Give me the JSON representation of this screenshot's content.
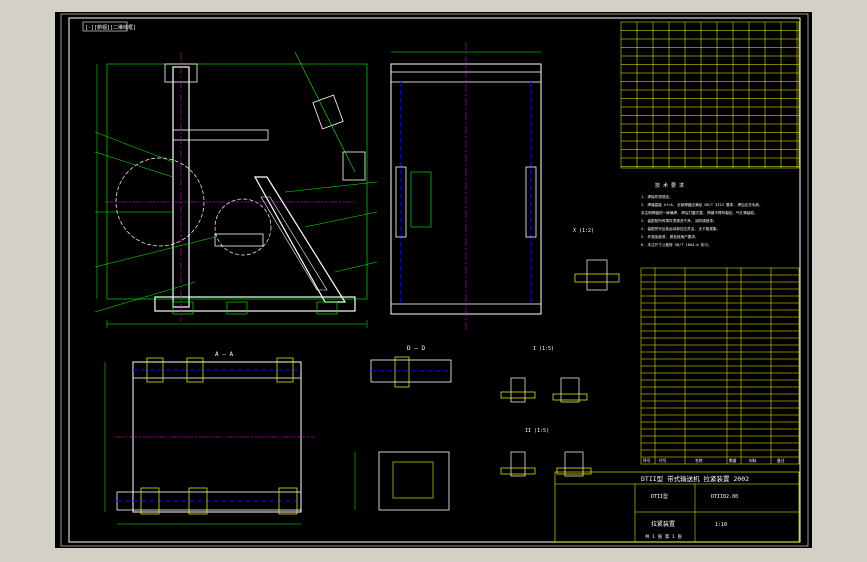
{
  "app": {
    "viewport_label": "[-][俯视][二维线框]",
    "background_color": "#d4d0c8",
    "canvas_color": "#000000"
  },
  "colors": {
    "frame": "#ffffff",
    "geometry": "#ffffff",
    "dimension": "#00ff00",
    "annotation": "#ffff00",
    "center_line": "#ff00ff",
    "hidden_line": "#0000ff",
    "table_line": "#ffff00",
    "table_text": "#ff00ff"
  },
  "drawing": {
    "title": "DTII型 带式输送机 拉紧装置 2002",
    "view_labels": {
      "section_aa": "A — A",
      "section_dd": "D — D",
      "detail_a": "X (1:2)",
      "detail_b": "I (1:5)",
      "detail_c": "II (1:5)"
    },
    "technical_requirements": {
      "heading": "技 术 要 求",
      "lines": [
        "1. 焊接件按规定。",
        "2. 焊缝高度 hf=6, 全部焊缝应满足 GB/T 3323 要求, 焊后应去毛刺。",
        "   未注明焊缝的一律满焊, 焊后打磨平整, 焊缝不得有裂纹、气孔等缺陷。",
        "3. 装配前所有零件须清洗干净, 涂防锈底漆。",
        "4. 装配完毕后各运动部位应灵活, 无卡阻现象。",
        "5. 外观涂面漆, 颜色按用户要求。",
        "6. 未注尺寸公差按 GB/T 1804-m 执行。"
      ]
    },
    "title_block": {
      "product_code": "DTII型",
      "scale": "1:10",
      "drawing_no": "DTII02.00",
      "part_name": "拉紧装置",
      "sheet": "共 1 张 第 1 张"
    },
    "parts_list_header": [
      "序号",
      "代号",
      "名称",
      "数量",
      "材料",
      "备注"
    ]
  }
}
